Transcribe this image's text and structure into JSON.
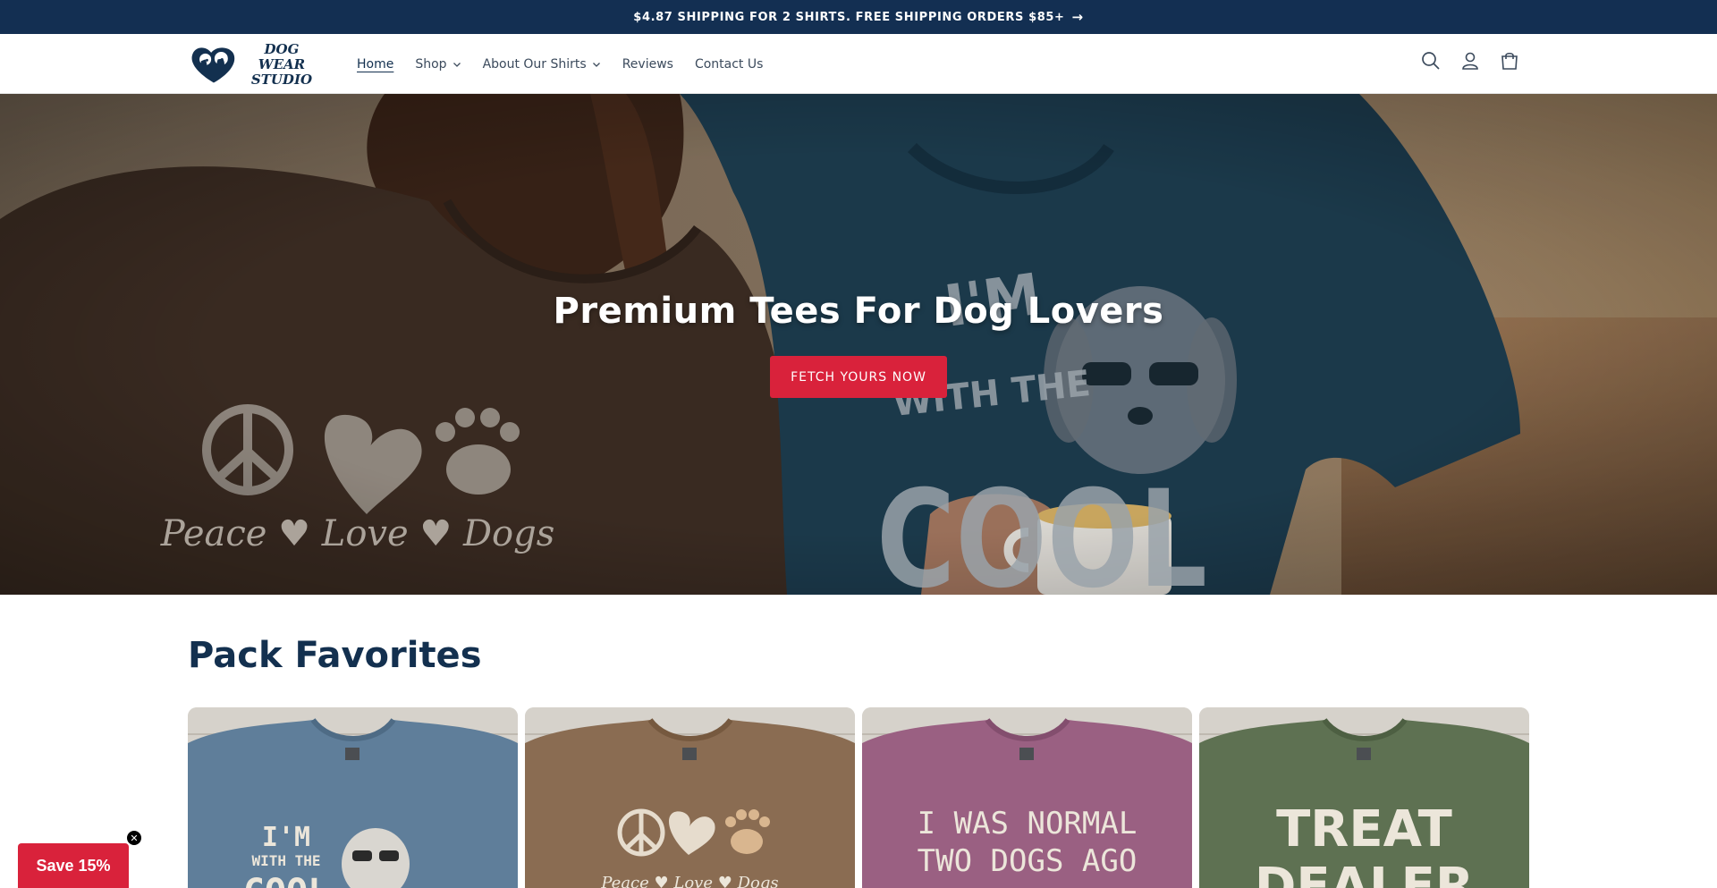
{
  "announcement": {
    "text": "$4.87 SHIPPING FOR 2 SHIRTS. FREE SHIPPING ORDERS $85+",
    "arrow_icon": "arrow-right-icon"
  },
  "header": {
    "logo_text_line1": "DOG WEAR",
    "logo_text_line2": "STUDIO",
    "nav": [
      {
        "label": "Home",
        "active": true
      },
      {
        "label": "Shop",
        "dropdown": true
      },
      {
        "label": "About Our Shirts",
        "dropdown": true
      },
      {
        "label": "Reviews"
      },
      {
        "label": "Contact Us"
      }
    ],
    "icons": [
      "search-icon",
      "account-icon",
      "cart-icon"
    ]
  },
  "hero": {
    "title": "Premium Tees For Dog Lovers",
    "button_label": "FETCH YOURS NOW",
    "shirt_left_caption": "Peace ♥ Love ♥ Dogs",
    "shirt_right_line1": "I'M",
    "shirt_right_line2": "WITH THE",
    "shirt_right_line3": "COOL"
  },
  "section": {
    "title": "Pack Favorites"
  },
  "products": [
    {
      "color": "#5f7e9a",
      "line1": "I'M",
      "line2": "WITH THE",
      "line3": "COOL"
    },
    {
      "color": "#8a6c52",
      "line1": "",
      "line2": "Peace ♥ Love ♥ Dogs",
      "line3": ""
    },
    {
      "color": "#9a6082",
      "line1": "I WAS NORMAL",
      "line2": "TWO DOGS AGO",
      "line3": ""
    },
    {
      "color": "#5e7152",
      "line1": "TREAT",
      "line2": "DEALER",
      "line3": ""
    }
  ],
  "popup": {
    "label": "Save 15%",
    "close_glyph": "✕"
  },
  "colors": {
    "navy": "#132f52",
    "accent_red": "#d9223b"
  }
}
